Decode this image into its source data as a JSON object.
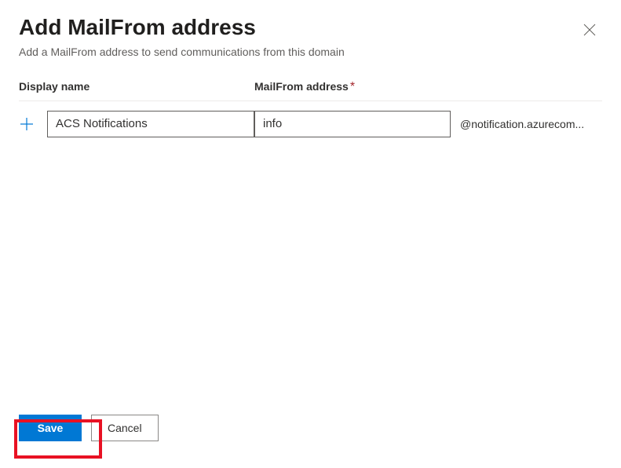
{
  "header": {
    "title": "Add MailFrom address",
    "subtitle": "Add a MailFrom address to send communications from this domain"
  },
  "form": {
    "displayName": {
      "label": "Display name",
      "value": "ACS Notifications"
    },
    "mailFrom": {
      "label": "MailFrom address",
      "required": "*",
      "value": "info"
    },
    "domainSuffix": "@notification.azurecom..."
  },
  "footer": {
    "save": "Save",
    "cancel": "Cancel"
  }
}
